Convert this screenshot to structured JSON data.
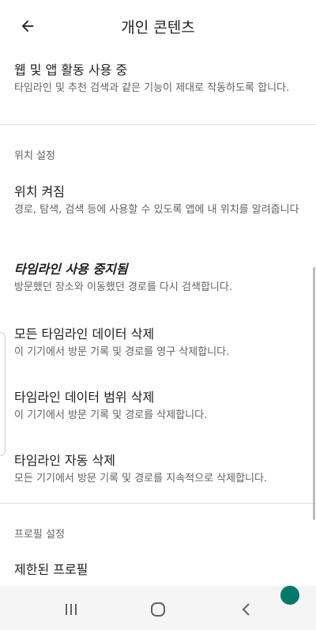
{
  "header": {
    "title": "개인 콘텐츠"
  },
  "items": {
    "web_app": {
      "title": "웹 및 앱 활동 사용 중",
      "subtitle": "타임라인 및 추천 검색과 같은 기능이 제대로 작동하도록 합니다."
    },
    "location_on": {
      "title": "위치 켜짐",
      "subtitle": "경로, 탐색, 검색 등에 사용할 수 있도록 앱에 내 위치를 알려줍니다"
    },
    "timeline_paused": {
      "title": "타임라인 사용 중지됨",
      "subtitle": "방문했던 장소와 이동했던 경로를 다시 검색합니다."
    },
    "delete_all": {
      "title": "모든 타임라인 데이터 삭제",
      "subtitle": "이 기기에서 방문 기록 및 경로를 영구 삭제합니다."
    },
    "delete_range": {
      "title": "타임라인 데이터 범위 삭제",
      "subtitle": "이 기기에서 방문 기록 및 경로를 삭제합니다."
    },
    "auto_delete": {
      "title": "타임라인 자동 삭제",
      "subtitle": "모든 기기에서 방문 기록 및 경로를 지속적으로 삭제합니다."
    },
    "restricted_profile": {
      "title": "제한된 프로필"
    }
  },
  "sections": {
    "location": "위치 설정",
    "profile": "프로필 설정"
  },
  "colors": {
    "accent": "#00796b",
    "text": "#202124",
    "secondary": "#5f6368"
  }
}
